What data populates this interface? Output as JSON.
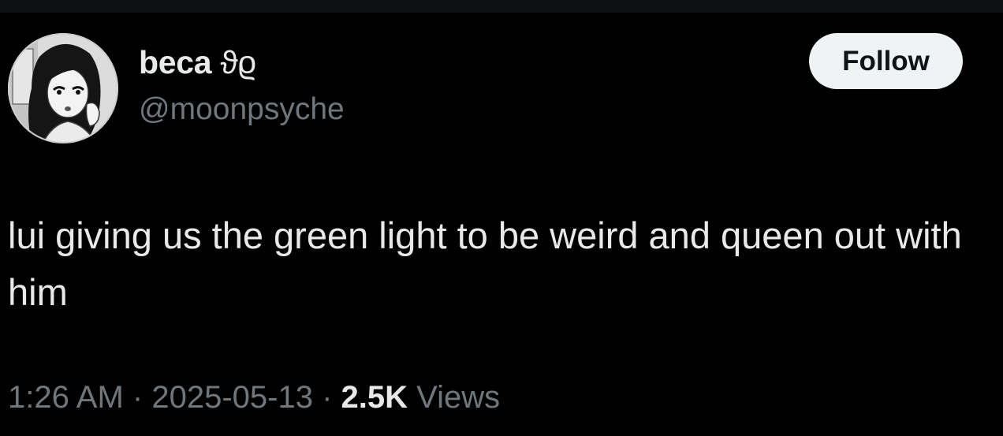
{
  "user": {
    "display_name": "beca",
    "name_glyphs": "ϑϱ",
    "handle": "@moonpsyche"
  },
  "follow_button": {
    "label": "Follow"
  },
  "tweet": {
    "text": "lui giving us the green light to be weird and queen out with him"
  },
  "meta": {
    "time": "1:26 AM",
    "separator": "·",
    "date": "2025-05-13",
    "views_count": "2.5K",
    "views_label": "Views"
  },
  "colors": {
    "background": "#000000",
    "primary_text": "#e7e9ea",
    "secondary_text": "#71767b",
    "button_bg": "#eff3f4",
    "button_text": "#0f1419"
  }
}
